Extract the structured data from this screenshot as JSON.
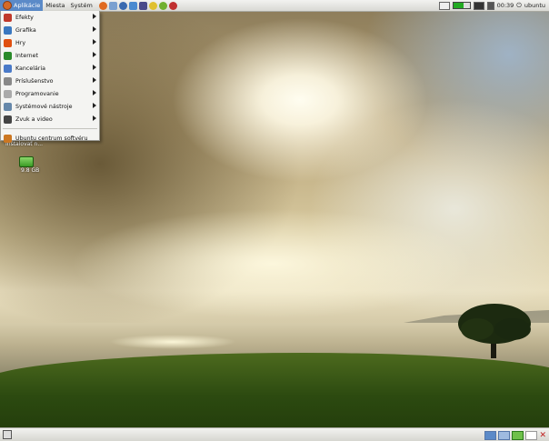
{
  "top_panel": {
    "menus": [
      "Aplikácie",
      "Miesta",
      "Systém"
    ],
    "clock": "00:39",
    "user": "ubuntu"
  },
  "app_menu": {
    "items": [
      {
        "label": "Efekty",
        "icon": "effects-icon",
        "color": "#c0392b"
      },
      {
        "label": "Grafika",
        "icon": "graphics-icon",
        "color": "#3a78c0"
      },
      {
        "label": "Hry",
        "icon": "games-icon",
        "color": "#e05010"
      },
      {
        "label": "Internet",
        "icon": "internet-icon",
        "color": "#2a8a2a"
      },
      {
        "label": "Kancelária",
        "icon": "office-icon",
        "color": "#4a7ac8"
      },
      {
        "label": "Príslušenstvo",
        "icon": "accessories-icon",
        "color": "#888888"
      },
      {
        "label": "Programovanie",
        "icon": "programming-icon",
        "color": "#aaaaaa"
      },
      {
        "label": "Systémové nástroje",
        "icon": "system-tools-icon",
        "color": "#6688aa"
      },
      {
        "label": "Zvuk a video",
        "icon": "sound-video-icon",
        "color": "#444444"
      }
    ],
    "footer_item": {
      "label": "Ubuntu centrum softvéru",
      "icon": "software-center-icon",
      "color": "#cc7722"
    }
  },
  "desktop": {
    "label_truncated": "Inštalovať n...",
    "disk_label": "9.8 GB"
  },
  "colors": {
    "menu_highlight": "#5b8ac8"
  }
}
